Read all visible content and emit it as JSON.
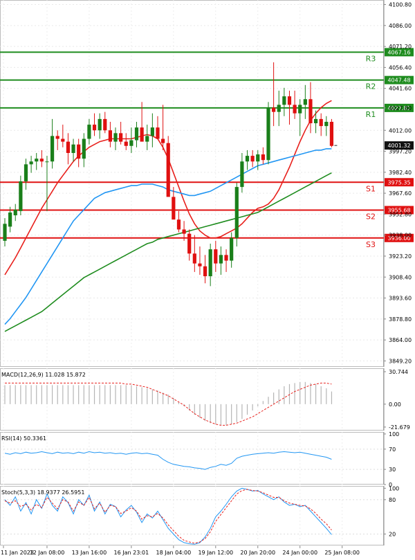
{
  "chart_data": [
    {
      "type": "candlestick",
      "panel": "price",
      "ylim": [
        3845,
        4104
      ],
      "y_ticks": [
        "4100.80",
        "4086.00",
        "4071.20",
        "4056.40",
        "4041.60",
        "4027.80",
        "4012.00",
        "3997.20",
        "3982.40",
        "3967.60",
        "3952.80",
        "3938.00",
        "3923.20",
        "3908.40",
        "3893.60",
        "3878.80",
        "3864.00",
        "3849.20"
      ],
      "x_ticks": [
        "11 Jan 2023",
        "12 Jan 08:00",
        "13 Jan 16:00",
        "16 Jan 23:01",
        "18 Jan 04:00",
        "19 Jan 12:00",
        "20 Jan 20:00",
        "24 Jan 00:00",
        "25 Jan 08:00"
      ],
      "levels": [
        {
          "label": "R3",
          "value": 4067.16,
          "tag": "4067.16",
          "kind": "resistance"
        },
        {
          "label": "R2",
          "value": 4047.48,
          "tag": "4047.48",
          "kind": "resistance"
        },
        {
          "label": "R1",
          "value": 4027.81,
          "tag": "4027.81",
          "kind": "resistance"
        },
        {
          "label": "S1",
          "value": 3975.35,
          "tag": "3975.35",
          "kind": "support"
        },
        {
          "label": "S2",
          "value": 3955.68,
          "tag": "3955.68",
          "kind": "support"
        },
        {
          "label": "S3",
          "value": 3936.0,
          "tag": "3936.00",
          "kind": "support"
        }
      ],
      "last_price": {
        "value": 4001.32,
        "tag": "4001.32"
      },
      "candles": [
        [
          3934,
          3950,
          3930,
          3946
        ],
        [
          3944,
          3958,
          3940,
          3954
        ],
        [
          3952,
          3960,
          3948,
          3956
        ],
        [
          3955,
          3980,
          3952,
          3976
        ],
        [
          3976,
          3992,
          3970,
          3988
        ],
        [
          3988,
          3994,
          3982,
          3990
        ],
        [
          3990,
          3996,
          3984,
          3992
        ],
        [
          3992,
          3998,
          3986,
          3990
        ],
        [
          3990,
          3994,
          3955,
          3990
        ],
        [
          3990,
          4020,
          3985,
          4008
        ],
        [
          4008,
          4012,
          3998,
          4006
        ],
        [
          4006,
          4016,
          4000,
          4004
        ],
        [
          4004,
          4010,
          3988,
          3996
        ],
        [
          3996,
          4006,
          3990,
          4002
        ],
        [
          4002,
          4006,
          3986,
          3992
        ],
        [
          3992,
          4010,
          3986,
          4006
        ],
        [
          4006,
          4020,
          4002,
          4016
        ],
        [
          4016,
          4024,
          4008,
          4012
        ],
        [
          4012,
          4024,
          4006,
          4020
        ],
        [
          4020,
          4025,
          4010,
          4012
        ],
        [
          4012,
          4018,
          4000,
          4004
        ],
        [
          4004,
          4014,
          3998,
          4010
        ],
        [
          4010,
          4018,
          4002,
          4004
        ],
        [
          4004,
          4010,
          3998,
          4001
        ],
        [
          4001,
          4014,
          3996,
          4005
        ],
        [
          4005,
          4018,
          4000,
          4014
        ],
        [
          4014,
          4032,
          4008,
          4004
        ],
        [
          4004,
          4016,
          3998,
          4008
        ],
        [
          4008,
          4024,
          4000,
          4014
        ],
        [
          4014,
          4022,
          4008,
          4006
        ],
        [
          4006,
          4030,
          3998,
          4003
        ],
        [
          4003,
          4008,
          3980,
          3965
        ],
        [
          3965,
          3972,
          3952,
          3949
        ],
        [
          3949,
          3955,
          3940,
          3942
        ],
        [
          3942,
          3948,
          3934,
          3939
        ],
        [
          3939,
          3942,
          3920,
          3925
        ],
        [
          3925,
          3938,
          3912,
          3918
        ],
        [
          3918,
          3930,
          3910,
          3916
        ],
        [
          3916,
          3924,
          3904,
          3909
        ],
        [
          3909,
          3932,
          3902,
          3928
        ],
        [
          3928,
          3934,
          3912,
          3918
        ],
        [
          3918,
          3930,
          3910,
          3924
        ],
        [
          3924,
          3928,
          3912,
          3920
        ],
        [
          3920,
          3940,
          3915,
          3936
        ],
        [
          3936,
          3975,
          3930,
          3972
        ],
        [
          3972,
          3996,
          3968,
          3990
        ],
        [
          3990,
          3998,
          3984,
          3994
        ],
        [
          3994,
          3998,
          3986,
          3990
        ],
        [
          3990,
          3998,
          3984,
          3995
        ],
        [
          3995,
          4000,
          3988,
          3991
        ],
        [
          3991,
          4032,
          3988,
          4028
        ],
        [
          4028,
          4060,
          4015,
          4025
        ],
        [
          4025,
          4040,
          4015,
          4030
        ],
        [
          4030,
          4042,
          4022,
          4036
        ],
        [
          4036,
          4040,
          4016,
          4030
        ],
        [
          4030,
          4040,
          4020,
          4024
        ],
        [
          4024,
          4034,
          4008,
          4030
        ],
        [
          4030,
          4044,
          4020,
          4034
        ],
        [
          4034,
          4046,
          4010,
          4017
        ],
        [
          4017,
          4026,
          4010,
          4020
        ],
        [
          4020,
          4024,
          4008,
          4015
        ],
        [
          4015,
          4022,
          4008,
          4018
        ],
        [
          4018,
          4020,
          4000,
          4001
        ]
      ],
      "series": [
        {
          "name": "",
          "color": "#e8201c",
          "role": "fast-ma",
          "values": [
            3910,
            3916,
            3922,
            3929,
            3936,
            3943,
            3950,
            3957,
            3963,
            3969,
            3975,
            3980,
            3985,
            3990,
            3994,
            3997,
            4000,
            4002,
            4004,
            4005,
            4006,
            4006,
            4006,
            4006,
            4006,
            4007,
            4008,
            4009,
            4008,
            4006,
            4000,
            3992,
            3982,
            3972,
            3962,
            3953,
            3946,
            3941,
            3938,
            3936,
            3936,
            3937,
            3939,
            3941,
            3943,
            3946,
            3950,
            3954,
            3957,
            3958,
            3960,
            3964,
            3970,
            3978,
            3986,
            3995,
            4004,
            4012,
            4019,
            4024,
            4028,
            4031,
            4033
          ]
        },
        {
          "name": "",
          "color": "#2196f3",
          "role": "medium-ma",
          "values": [
            3875,
            3879,
            3884,
            3889,
            3894,
            3900,
            3906,
            3912,
            3918,
            3924,
            3930,
            3936,
            3942,
            3948,
            3952,
            3956,
            3960,
            3964,
            3966,
            3968,
            3969,
            3970,
            3971,
            3972,
            3973,
            3973,
            3974,
            3974,
            3974,
            3973,
            3972,
            3970,
            3969,
            3968,
            3967,
            3966,
            3966,
            3967,
            3968,
            3969,
            3971,
            3973,
            3975,
            3977,
            3979,
            3981,
            3983,
            3985,
            3987,
            3988,
            3989,
            3990,
            3991,
            3992,
            3993,
            3994,
            3995,
            3996,
            3997,
            3998,
            3998,
            3999,
            3999
          ]
        },
        {
          "name": "",
          "color": "#1e8c1e",
          "role": "slow-ma",
          "values": [
            3870,
            3872,
            3874,
            3876,
            3878,
            3880,
            3882,
            3884,
            3887,
            3890,
            3893,
            3896,
            3899,
            3902,
            3905,
            3908,
            3910,
            3912,
            3914,
            3916,
            3918,
            3920,
            3922,
            3924,
            3926,
            3928,
            3930,
            3932,
            3933,
            3935,
            3936,
            3937,
            3938,
            3939,
            3940,
            3941,
            3942,
            3943,
            3944,
            3945,
            3946,
            3947,
            3948,
            3949,
            3950,
            3951,
            3952,
            3953,
            3954,
            3956,
            3958,
            3960,
            3962,
            3964,
            3966,
            3968,
            3970,
            3972,
            3974,
            3976,
            3978,
            3980,
            3982
          ]
        }
      ]
    },
    {
      "type": "bar+line",
      "panel": "macd",
      "label": "MACD(12,26,9) 11.028 15.872",
      "ylim": [
        -25,
        34
      ],
      "y_ticks": [
        {
          "text": "30.744",
          "value": 30.744
        },
        {
          "text": "0.00",
          "value": 0
        },
        {
          "text": "-21.679",
          "value": -21.679
        }
      ],
      "histogram": [
        18,
        18,
        18,
        18,
        18,
        18,
        18,
        18,
        18,
        18,
        18,
        18,
        18,
        18,
        18,
        18,
        18,
        18,
        18,
        18,
        18,
        18,
        18,
        18,
        18,
        17,
        16,
        15,
        14,
        13,
        11,
        9,
        6,
        2,
        -2,
        -6,
        -10,
        -13,
        -16,
        -18,
        -19,
        -20,
        -20,
        -19,
        -17,
        -14,
        -10,
        -6,
        -2,
        3,
        7,
        11,
        14,
        17,
        19,
        20,
        21,
        21,
        20,
        19,
        17,
        15,
        12
      ],
      "signal": [
        20,
        20,
        20,
        20,
        20,
        20,
        20,
        20,
        20,
        20,
        20,
        20,
        20,
        20,
        20,
        20,
        20,
        20,
        20,
        20,
        20,
        20,
        20,
        19,
        19,
        18,
        17,
        16,
        14,
        12,
        10,
        8,
        5,
        2,
        -1,
        -5,
        -9,
        -12,
        -15,
        -17,
        -19,
        -20,
        -20,
        -19,
        -18,
        -16,
        -14,
        -12,
        -9,
        -6,
        -3,
        0,
        3,
        6,
        9,
        12,
        14,
        16,
        18,
        19,
        20,
        20,
        19
      ]
    },
    {
      "type": "line",
      "panel": "rsi",
      "label": "RSI(14) 50.3361",
      "ylim": [
        0,
        104
      ],
      "y_ticks": [
        {
          "text": "100",
          "value": 100
        },
        {
          "text": "70",
          "value": 70
        },
        {
          "text": "30",
          "value": 30
        },
        {
          "text": "0",
          "value": 0
        }
      ],
      "series": [
        {
          "name": "",
          "color": "#2196f3",
          "values": [
            62,
            60,
            63,
            61,
            64,
            62,
            63,
            65,
            63,
            61,
            64,
            62,
            63,
            61,
            64,
            62,
            65,
            63,
            64,
            62,
            63,
            61,
            62,
            60,
            62,
            63,
            61,
            62,
            60,
            58,
            50,
            44,
            40,
            38,
            36,
            35,
            33,
            32,
            30,
            34,
            36,
            40,
            38,
            42,
            52,
            56,
            58,
            60,
            61,
            62,
            63,
            62,
            64,
            65,
            64,
            63,
            64,
            62,
            60,
            58,
            56,
            54,
            50
          ]
        }
      ]
    },
    {
      "type": "line",
      "panel": "stoch",
      "label": "Stoch(5,3,3) 18.9377 26.5951",
      "ylim": [
        0,
        104
      ],
      "y_ticks": [
        {
          "text": "100",
          "value": 100
        },
        {
          "text": "80",
          "value": 80
        },
        {
          "text": "20",
          "value": 20
        }
      ],
      "series": [
        {
          "name": "",
          "color": "#2196f3",
          "values": [
            80,
            70,
            85,
            60,
            75,
            55,
            80,
            65,
            90,
            70,
            60,
            85,
            75,
            55,
            80,
            70,
            88,
            60,
            76,
            55,
            72,
            68,
            50,
            62,
            70,
            58,
            40,
            55,
            48,
            60,
            45,
            30,
            20,
            10,
            5,
            3,
            2,
            5,
            15,
            30,
            50,
            60,
            72,
            85,
            95,
            100,
            98,
            95,
            96,
            90,
            85,
            80,
            85,
            76,
            70,
            72,
            68,
            70,
            60,
            50,
            40,
            30,
            19
          ]
        },
        {
          "name": "",
          "color": "#e8201c",
          "values": [
            78,
            74,
            78,
            68,
            72,
            62,
            72,
            66,
            84,
            74,
            64,
            80,
            76,
            60,
            76,
            70,
            84,
            64,
            74,
            58,
            70,
            68,
            56,
            60,
            66,
            60,
            46,
            52,
            50,
            56,
            48,
            36,
            26,
            16,
            9,
            6,
            4,
            6,
            12,
            24,
            42,
            54,
            66,
            78,
            90,
            96,
            98,
            96,
            95,
            92,
            88,
            84,
            84,
            78,
            74,
            72,
            70,
            69,
            64,
            56,
            46,
            38,
            27
          ]
        }
      ]
    }
  ]
}
